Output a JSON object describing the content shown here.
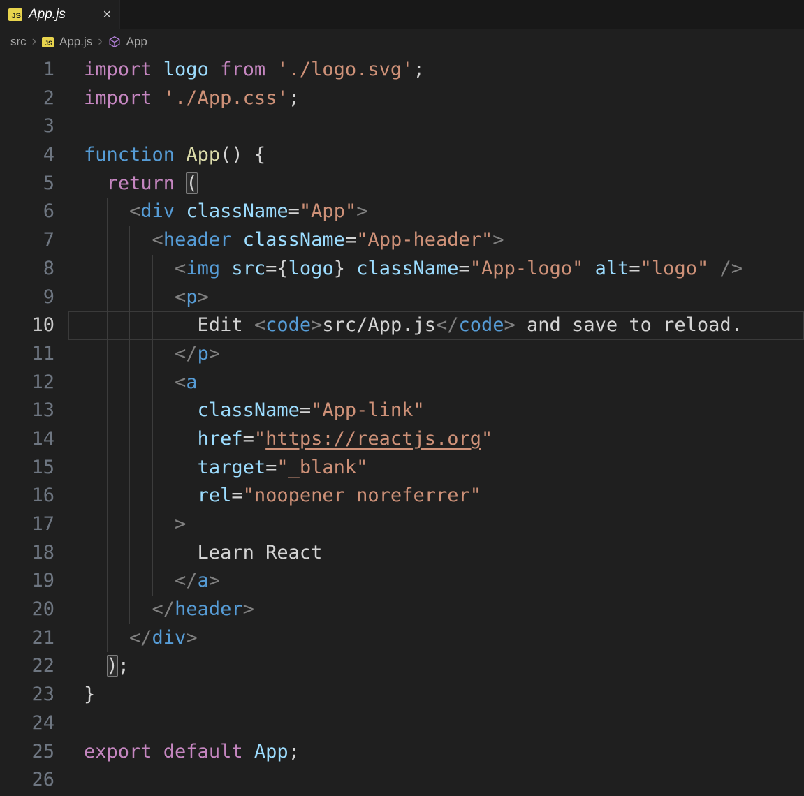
{
  "tab": {
    "title": "App.js",
    "close_glyph": "×"
  },
  "icons": {
    "js_badge": "JS"
  },
  "breadcrumbs": {
    "items": [
      "src",
      "App.js",
      "App"
    ],
    "separator": "›"
  },
  "colors": {
    "background": "#1f1f1f",
    "tab_strip": "#181818",
    "js_badge": "#E8D44D",
    "symbol_icon": "#B180D7",
    "line_number": "#6e7681",
    "active_line_number": "#c8c8c8"
  },
  "editor": {
    "current_line": 10,
    "palette": {
      "kw": "#C586C0",
      "blu": "#569CD6",
      "fn": "#DCDCAA",
      "var": "#9CDCFE",
      "str": "#CE9178",
      "pun": "#808080",
      "pln": "#D4D4D4",
      "lnk": "#CE9178",
      "bm": "#D4D4D4"
    },
    "lines": [
      {
        "n": 1,
        "indent": 0,
        "tokens": [
          {
            "t": "import ",
            "c": "kw"
          },
          {
            "t": "logo ",
            "c": "var"
          },
          {
            "t": "from ",
            "c": "kw"
          },
          {
            "t": "'./logo.svg'",
            "c": "str"
          },
          {
            "t": ";",
            "c": "pln"
          }
        ]
      },
      {
        "n": 2,
        "indent": 0,
        "tokens": [
          {
            "t": "import ",
            "c": "kw"
          },
          {
            "t": "'./App.css'",
            "c": "str"
          },
          {
            "t": ";",
            "c": "pln"
          }
        ]
      },
      {
        "n": 3,
        "indent": 0,
        "tokens": []
      },
      {
        "n": 4,
        "indent": 0,
        "tokens": [
          {
            "t": "function ",
            "c": "blu"
          },
          {
            "t": "App",
            "c": "fn"
          },
          {
            "t": "() {",
            "c": "pln"
          }
        ]
      },
      {
        "n": 5,
        "indent": 2,
        "tokens": [
          {
            "t": "  ",
            "c": "pln"
          },
          {
            "t": "return ",
            "c": "kw"
          },
          {
            "t": "(",
            "c": "bm"
          }
        ]
      },
      {
        "n": 6,
        "indent": 4,
        "tokens": [
          {
            "t": "    ",
            "c": "pln"
          },
          {
            "t": "<",
            "c": "pun"
          },
          {
            "t": "div",
            "c": "blu"
          },
          {
            "t": " ",
            "c": "pln"
          },
          {
            "t": "className",
            "c": "var"
          },
          {
            "t": "=",
            "c": "pln"
          },
          {
            "t": "\"App\"",
            "c": "str"
          },
          {
            "t": ">",
            "c": "pun"
          }
        ]
      },
      {
        "n": 7,
        "indent": 6,
        "tokens": [
          {
            "t": "      ",
            "c": "pln"
          },
          {
            "t": "<",
            "c": "pun"
          },
          {
            "t": "header",
            "c": "blu"
          },
          {
            "t": " ",
            "c": "pln"
          },
          {
            "t": "className",
            "c": "var"
          },
          {
            "t": "=",
            "c": "pln"
          },
          {
            "t": "\"App-header\"",
            "c": "str"
          },
          {
            "t": ">",
            "c": "pun"
          }
        ]
      },
      {
        "n": 8,
        "indent": 8,
        "tokens": [
          {
            "t": "        ",
            "c": "pln"
          },
          {
            "t": "<",
            "c": "pun"
          },
          {
            "t": "img",
            "c": "blu"
          },
          {
            "t": " ",
            "c": "pln"
          },
          {
            "t": "src",
            "c": "var"
          },
          {
            "t": "=",
            "c": "pln"
          },
          {
            "t": "{",
            "c": "pln"
          },
          {
            "t": "logo",
            "c": "var"
          },
          {
            "t": "} ",
            "c": "pln"
          },
          {
            "t": "className",
            "c": "var"
          },
          {
            "t": "=",
            "c": "pln"
          },
          {
            "t": "\"App-logo\"",
            "c": "str"
          },
          {
            "t": " ",
            "c": "pln"
          },
          {
            "t": "alt",
            "c": "var"
          },
          {
            "t": "=",
            "c": "pln"
          },
          {
            "t": "\"logo\"",
            "c": "str"
          },
          {
            "t": " ",
            "c": "pln"
          },
          {
            "t": "/>",
            "c": "pun"
          }
        ]
      },
      {
        "n": 9,
        "indent": 8,
        "tokens": [
          {
            "t": "        ",
            "c": "pln"
          },
          {
            "t": "<",
            "c": "pun"
          },
          {
            "t": "p",
            "c": "blu"
          },
          {
            "t": ">",
            "c": "pun"
          }
        ]
      },
      {
        "n": 10,
        "indent": 10,
        "tokens": [
          {
            "t": "          Edit ",
            "c": "pln"
          },
          {
            "t": "<",
            "c": "pun"
          },
          {
            "t": "code",
            "c": "blu"
          },
          {
            "t": ">",
            "c": "pun"
          },
          {
            "t": "src/App.js",
            "c": "pln"
          },
          {
            "t": "</",
            "c": "pun"
          },
          {
            "t": "code",
            "c": "blu"
          },
          {
            "t": ">",
            "c": "pun"
          },
          {
            "t": " and save to reload.",
            "c": "pln"
          }
        ]
      },
      {
        "n": 11,
        "indent": 8,
        "tokens": [
          {
            "t": "        ",
            "c": "pln"
          },
          {
            "t": "</",
            "c": "pun"
          },
          {
            "t": "p",
            "c": "blu"
          },
          {
            "t": ">",
            "c": "pun"
          }
        ]
      },
      {
        "n": 12,
        "indent": 8,
        "tokens": [
          {
            "t": "        ",
            "c": "pln"
          },
          {
            "t": "<",
            "c": "pun"
          },
          {
            "t": "a",
            "c": "blu"
          }
        ]
      },
      {
        "n": 13,
        "indent": 10,
        "tokens": [
          {
            "t": "          ",
            "c": "pln"
          },
          {
            "t": "className",
            "c": "var"
          },
          {
            "t": "=",
            "c": "pln"
          },
          {
            "t": "\"App-link\"",
            "c": "str"
          }
        ]
      },
      {
        "n": 14,
        "indent": 10,
        "tokens": [
          {
            "t": "          ",
            "c": "pln"
          },
          {
            "t": "href",
            "c": "var"
          },
          {
            "t": "=",
            "c": "pln"
          },
          {
            "t": "\"",
            "c": "str"
          },
          {
            "t": "https://reactjs.org",
            "c": "lnk"
          },
          {
            "t": "\"",
            "c": "str"
          }
        ]
      },
      {
        "n": 15,
        "indent": 10,
        "tokens": [
          {
            "t": "          ",
            "c": "pln"
          },
          {
            "t": "target",
            "c": "var"
          },
          {
            "t": "=",
            "c": "pln"
          },
          {
            "t": "\"_blank\"",
            "c": "str"
          }
        ]
      },
      {
        "n": 16,
        "indent": 10,
        "tokens": [
          {
            "t": "          ",
            "c": "pln"
          },
          {
            "t": "rel",
            "c": "var"
          },
          {
            "t": "=",
            "c": "pln"
          },
          {
            "t": "\"noopener noreferrer\"",
            "c": "str"
          }
        ]
      },
      {
        "n": 17,
        "indent": 8,
        "tokens": [
          {
            "t": "        ",
            "c": "pln"
          },
          {
            "t": ">",
            "c": "pun"
          }
        ]
      },
      {
        "n": 18,
        "indent": 10,
        "tokens": [
          {
            "t": "          Learn React",
            "c": "pln"
          }
        ]
      },
      {
        "n": 19,
        "indent": 8,
        "tokens": [
          {
            "t": "        ",
            "c": "pln"
          },
          {
            "t": "</",
            "c": "pun"
          },
          {
            "t": "a",
            "c": "blu"
          },
          {
            "t": ">",
            "c": "pun"
          }
        ]
      },
      {
        "n": 20,
        "indent": 6,
        "tokens": [
          {
            "t": "      ",
            "c": "pln"
          },
          {
            "t": "</",
            "c": "pun"
          },
          {
            "t": "header",
            "c": "blu"
          },
          {
            "t": ">",
            "c": "pun"
          }
        ]
      },
      {
        "n": 21,
        "indent": 4,
        "tokens": [
          {
            "t": "    ",
            "c": "pln"
          },
          {
            "t": "</",
            "c": "pun"
          },
          {
            "t": "div",
            "c": "blu"
          },
          {
            "t": ">",
            "c": "pun"
          }
        ]
      },
      {
        "n": 22,
        "indent": 2,
        "tokens": [
          {
            "t": "  ",
            "c": "pln"
          },
          {
            "t": ")",
            "c": "bm"
          },
          {
            "t": ";",
            "c": "pln"
          }
        ]
      },
      {
        "n": 23,
        "indent": 0,
        "tokens": [
          {
            "t": "}",
            "c": "pln"
          }
        ]
      },
      {
        "n": 24,
        "indent": 0,
        "tokens": []
      },
      {
        "n": 25,
        "indent": 0,
        "tokens": [
          {
            "t": "export ",
            "c": "kw"
          },
          {
            "t": "default ",
            "c": "kw"
          },
          {
            "t": "App",
            "c": "var"
          },
          {
            "t": ";",
            "c": "pln"
          }
        ]
      },
      {
        "n": 26,
        "indent": 0,
        "tokens": []
      }
    ]
  }
}
